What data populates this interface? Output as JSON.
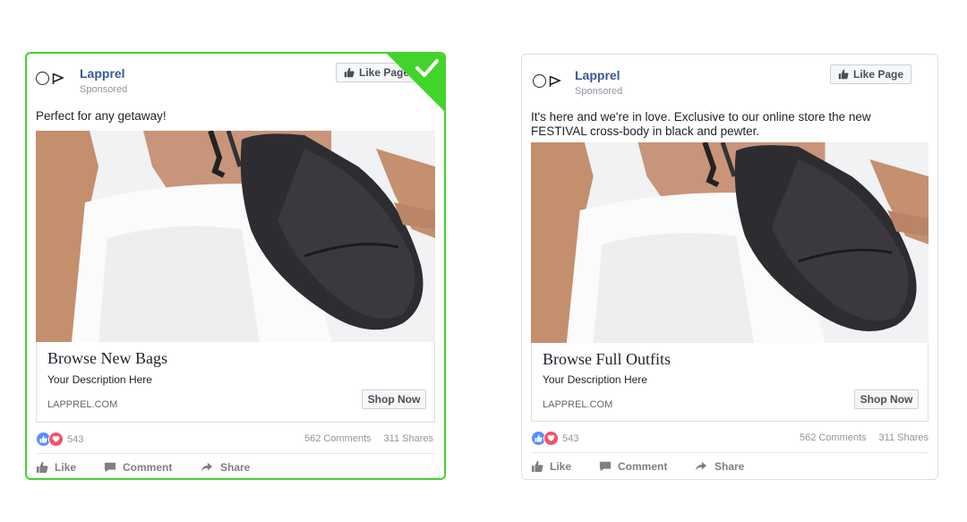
{
  "colors": {
    "brand_link": "#365899",
    "selected_border": "#42d42a",
    "like_reaction": "#5890ff",
    "love_reaction": "#f25268"
  },
  "ads": [
    {
      "selected": true,
      "logo_mark": "O▷",
      "page_name": "Lapprel",
      "sponsored": "Sponsored",
      "like_page_label": "Like Page",
      "text": "Perfect for any getaway!",
      "image_icon": "woman-with-black-crossbody-bag-photo",
      "headline": "Browse New Bags",
      "description": "Your Description Here",
      "domain": "LAPPREL.COM",
      "cta_label": "Shop Now",
      "reaction_count": "543",
      "comments": "562 Comments",
      "shares": "311 Shares",
      "actions": {
        "like": "Like",
        "comment": "Comment",
        "share": "Share"
      }
    },
    {
      "selected": false,
      "logo_mark": "O▷",
      "page_name": "Lapprel",
      "sponsored": "Sponsored",
      "like_page_label": "Like Page",
      "text": "It's here and we're in love. Exclusive to our online store the new FESTIVAL cross-body in black and pewter.",
      "image_icon": "woman-with-black-crossbody-bag-photo",
      "headline": "Browse Full Outfits",
      "description": "Your Description Here",
      "domain": "LAPPREL.COM",
      "cta_label": "Shop Now",
      "reaction_count": "543",
      "comments": "562 Comments",
      "shares": "311 Shares",
      "actions": {
        "like": "Like",
        "comment": "Comment",
        "share": "Share"
      }
    }
  ]
}
